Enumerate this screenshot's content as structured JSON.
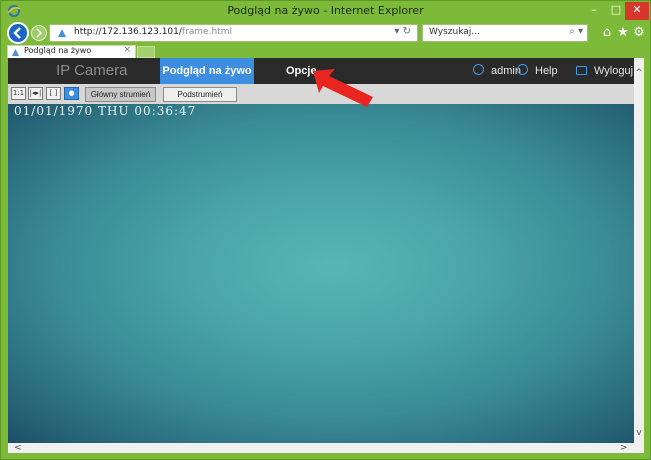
{
  "window": {
    "title": "Podgląd na żywo - Internet Explorer",
    "controls": {
      "minimize": "–",
      "maximize": "□",
      "close": "✕"
    }
  },
  "address_bar": {
    "url_host": "http://172.136.123.101/",
    "url_path": "frame.html",
    "controls": "▾ ↻"
  },
  "search": {
    "placeholder": "Wyszukaj...",
    "icon_text": "⌕ ▾"
  },
  "tab": {
    "label": "Podgląd na żywo",
    "close": "×"
  },
  "camera_header": {
    "brand": "IP Camera",
    "nav_live": "Podgląd na żywo",
    "nav_options": "Opcje",
    "user": "admin",
    "help": "Help",
    "logout": "Wyloguj"
  },
  "player_toolbar": {
    "buttons": [
      "1:1",
      "|◂▸|",
      "[ ]",
      "●"
    ],
    "stream_main": "Główny strumień",
    "stream_sub": "Podstrumień"
  },
  "video": {
    "osd_text": "01/01/1970 THU 00:36:47"
  },
  "colors": {
    "frame": "#7dba3a",
    "camera_header_bg": "#2a2a2a",
    "active_nav": "#3d8de0",
    "annotation_arrow": "#e8251f"
  }
}
